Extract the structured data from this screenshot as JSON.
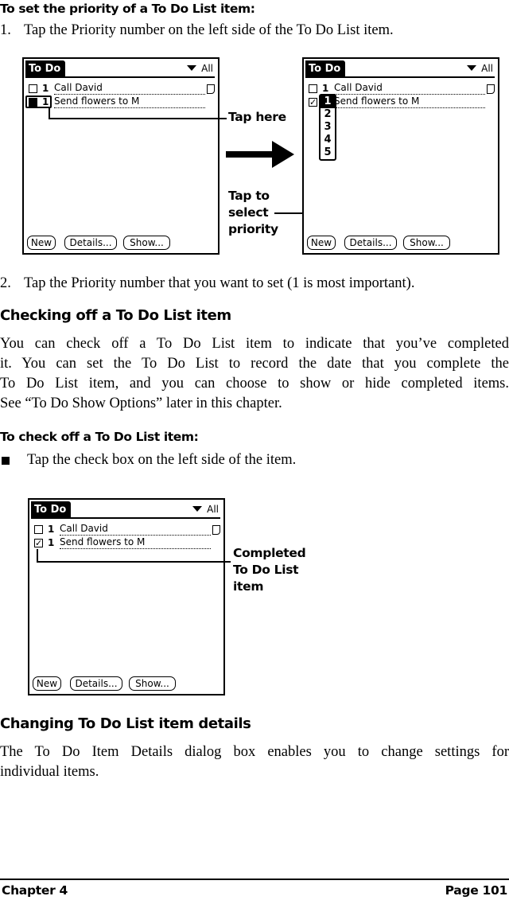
{
  "section1": {
    "procedure_title": "To set the priority of a To Do List item:",
    "steps": [
      {
        "number": "1.",
        "text": "Tap the Priority number on the left side of the To Do List item."
      },
      {
        "number": "2.",
        "text": "Tap the Priority number that you want to set (1 is most important)."
      }
    ]
  },
  "figure1": {
    "left_screen": {
      "title": "To Do",
      "category": "All",
      "items": [
        {
          "checked": false,
          "priority": "1",
          "description": "Call David",
          "has_note": true
        },
        {
          "checked": false,
          "priority": "1",
          "description": "Send flowers to M",
          "has_note": false
        }
      ],
      "buttons": [
        "New",
        "Details...",
        "Show..."
      ]
    },
    "right_screen": {
      "title": "To Do",
      "category": "All",
      "items": [
        {
          "checked": false,
          "priority": "1",
          "description": "Call David",
          "has_note": true
        },
        {
          "checked": true,
          "priority": "1",
          "description": "Send flowers to M",
          "has_note": false
        }
      ],
      "priority_popup": [
        "1",
        "2",
        "3",
        "4",
        "5"
      ],
      "priority_popup_selected": "1",
      "buttons": [
        "New",
        "Details...",
        "Show..."
      ]
    },
    "callouts": {
      "tap_here": "Tap here",
      "tap_to_select": [
        "Tap to",
        "select",
        "priority"
      ]
    }
  },
  "section2": {
    "heading": "Checking off a To Do List item",
    "paragraph_lines": [
      "You can check off a To Do List item to indicate that you’ve completed",
      "it. You can set the To Do List to record the date that you complete the",
      "To Do List item, and you can choose to show or hide completed items.",
      "See “To Do Show Options” later in this chapter."
    ],
    "procedure_title": "To check off a To Do List item:",
    "bullet": "Tap the check box on the left side of the item."
  },
  "figure2": {
    "screen": {
      "title": "To Do",
      "category": "All",
      "items": [
        {
          "checked": false,
          "priority": "1",
          "description": "Call David",
          "has_note": true
        },
        {
          "checked": true,
          "priority": "1",
          "description": "Send flowers to M",
          "has_note": false
        }
      ],
      "buttons": [
        "New",
        "Details...",
        "Show..."
      ]
    },
    "callout": [
      "Completed",
      "To Do List",
      "item"
    ]
  },
  "section3": {
    "heading": "Changing To Do List item details",
    "paragraph_lines": [
      "The To Do Item Details dialog box enables you to change settings for",
      "individual items."
    ]
  },
  "footer": {
    "chapter": "Chapter 4",
    "page": "Page 101"
  }
}
